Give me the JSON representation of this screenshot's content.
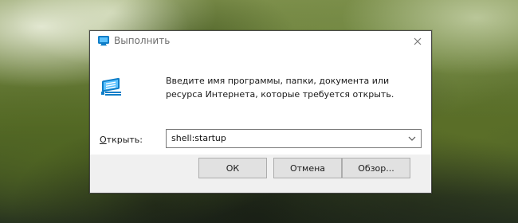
{
  "window": {
    "title": "Выполнить"
  },
  "content": {
    "description": "Введите имя программы, папки, документа или ресурса Интернета, которые требуется открыть.",
    "open_label_mnemonic": "О",
    "open_label_rest": "ткрыть:",
    "input_value": "shell:startup"
  },
  "buttons": {
    "ok": "ОК",
    "cancel": "Отмена",
    "browse": "Обзор..."
  },
  "icons": {
    "title": "run-icon",
    "large": "run-icon",
    "close": "close-icon",
    "dropdown": "chevron-down-icon"
  },
  "colors": {
    "dialog_bg": "#f0f0f0",
    "content_bg": "#ffffff",
    "button_bg": "#e1e1e1",
    "border": "#7a7a7a"
  }
}
